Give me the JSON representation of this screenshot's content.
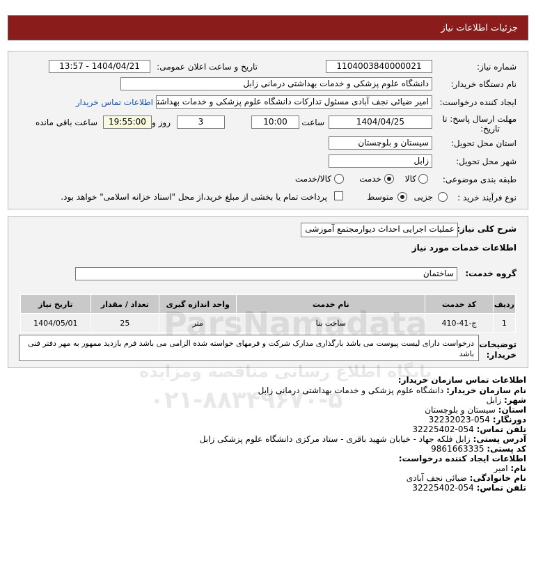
{
  "header": {
    "title": "جزئیات اطلاعات نیاز"
  },
  "top": {
    "need_number_label": "شماره نیاز:",
    "need_number": "1104003840000021",
    "announce_label": "تاریخ و ساعت اعلان عمومی:",
    "announce_value": "1404/04/21 - 13:57",
    "buyer_org_label": "نام دستگاه خریدار:",
    "buyer_org": "دانشگاه علوم پزشکی و خدمات بهداشتی درمانی زابل",
    "creator_label": "ایجاد کننده درخواست:",
    "creator": "امیر ضیائی نجف آبادی مسئول تدارکات  دانشگاه علوم پزشکی و خدمات بهداشتی",
    "contact_link": "اطلاعات تماس خریدار",
    "deadline_label_1": "مهلت ارسال پاسخ: تا",
    "deadline_label_2": "تاریخ:",
    "deadline_date": "1404/04/25",
    "time_label": "ساعت",
    "deadline_time": "10:00",
    "days_value": "3",
    "days_label": "روز و",
    "remaining_time": "19:55:00",
    "remaining_label": "ساعت باقی مانده",
    "province_label": "استان محل تحویل:",
    "province": "سیستان و بلوچستان",
    "city_label": "شهر محل تحویل:",
    "city": "زابل",
    "category_label": "طبقه بندی موضوعی:",
    "category_options": [
      "کالا",
      "خدمت",
      "کالا/خدمت"
    ],
    "process_label": "نوع فرآیند خرید :",
    "process_options": [
      "جزیی",
      "متوسط"
    ],
    "payment_text": "پرداخت تمام یا بخشی از مبلغ خرید،از محل \"اسناد خزانه اسلامی\" خواهد بود."
  },
  "details": {
    "summary_label": "شرح کلی نیاز:",
    "summary": "عملیات اجرایی احداث دیوارمجتمع آموزشی",
    "services_title": "اطلاعات خدمات مورد نیاز",
    "group_label": "گروه خدمت:",
    "group_value": "ساختمان",
    "table": {
      "headers": [
        "ردیف",
        "کد خدمت",
        "نام خدمت",
        "واحد اندازه گیری",
        "تعداد / مقدار",
        "تاریخ نیاز"
      ],
      "rows": [
        [
          "1",
          "ج-41-410",
          "ساخت بنا",
          "متر",
          "25",
          "1404/05/01"
        ]
      ]
    },
    "notes_label_1": "توضیحات",
    "notes_label_2": "خریدار:",
    "notes": "درخواست دارای لیست پیوست می باشد بارگذاری مدارک شرکت و فرمهای خواسته شده الزامی می باشد فرم بازدید ممهور به مهر دفتر فنی باشد"
  },
  "buyer_contact": {
    "title": "اطلاعات تماس سازمان خریدار:",
    "org_label": "نام سازمان خریدار:",
    "org": "دانشگاه علوم پزشکی و خدمات بهداشتی درمانی زابل",
    "city_label": "شهر:",
    "city": "زابل",
    "province_label": "استان:",
    "province": "سیستان و بلوچستان",
    "fax_label": "دورنگار:",
    "fax": "054-32232023",
    "phone_label": "تلفن تماس:",
    "phone": "054-32225402",
    "address_label": "آدرس پستی:",
    "address": "زابل فلکه جهاد - خیابان شهید باقری - ستاد مرکزی دانشگاه علوم پزشکی زابل",
    "postal_label": "کد پستی:",
    "postal": "9861663335"
  },
  "creator_contact": {
    "title": "اطلاعات ایجاد کننده درخواست:",
    "name_label": "نام:",
    "name": "امیر",
    "family_label": "نام خانوادگی:",
    "family": "ضیائی نجف آبادی",
    "phone_label": "تلفن تماس:",
    "phone": "054-32225402"
  },
  "watermark": {
    "brand": "ParsNamadata",
    "line1": "پایگاه اطلاع رسانی مناقصه ومزایده",
    "phone": "۰۲۱-۸۸۳۴۹۶۷۰-۵"
  }
}
